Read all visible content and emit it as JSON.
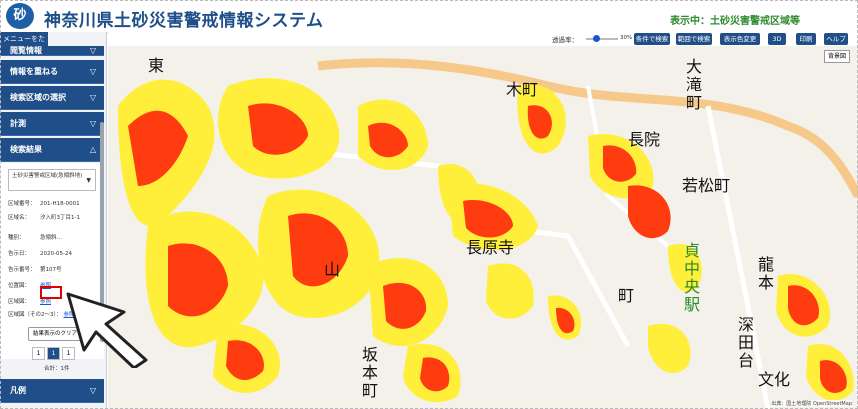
{
  "header": {
    "logo_text": "砂",
    "title": "神奈川県土砂災害警戒情報システム",
    "display_status": "表示中：土砂災害警戒区域等"
  },
  "sidebar": {
    "menu_toggle": "メニューをたたむ",
    "sections": [
      {
        "label": "閲覧情報",
        "chevron": "▽"
      },
      {
        "label": "情報を重ねる",
        "chevron": "▽"
      },
      {
        "label": "検索区域の選択",
        "chevron": "▽"
      },
      {
        "label": "計測",
        "chevron": "▽"
      },
      {
        "label": "検索結果",
        "chevron": "△"
      }
    ],
    "result": {
      "dropdown_value": "土砂災害警戒区域(急傾斜地)",
      "rows": [
        {
          "key": "区域番号：",
          "value": "201-H18-0001"
        },
        {
          "key": "区域名：",
          "value": "汐入町3丁目1-1"
        },
        {
          "key": "種別：",
          "value": "急傾斜…"
        },
        {
          "key": "告示日：",
          "value": "2020-05-24"
        },
        {
          "key": "告示番号：",
          "value": "第107号"
        }
      ],
      "position_map_key": "位置図：",
      "position_map_link": "参照",
      "area_map_key": "区域図：",
      "area_map_link": "参照",
      "area_map2_key": "区域図（その2〜3）：",
      "area_map2_link": "参照",
      "clear_button": "結果表示のクリア",
      "pages": [
        "1",
        "1",
        "1"
      ],
      "total": "合計：1件"
    },
    "legend_label": "凡例",
    "legend_chevron": "▽"
  },
  "toolbar": {
    "opacity_label": "透過率：",
    "opacity_value": "30%",
    "opacity_fraction": 0.3,
    "buttons": [
      "条件で検索",
      "範囲で検索",
      "表示色変更",
      "3D",
      "印刷",
      "ヘルプ"
    ]
  },
  "map": {
    "background_button": "背景図",
    "attribution": "出典：国土地理院 OpenStreetMap",
    "labels": [
      "東",
      "木町",
      "大滝町",
      "長院",
      "若松町",
      "長原寺",
      "龍本",
      "深田台",
      "文化",
      "坂本町",
      "山",
      "町",
      "貞中央駅"
    ],
    "colors": {
      "red_zone": "#ff3b10",
      "yellow_zone": "#ffef3a",
      "road": "#f6c98a"
    }
  },
  "colors": {
    "brand": "#1f4e88",
    "status": "#2f8a2f"
  }
}
